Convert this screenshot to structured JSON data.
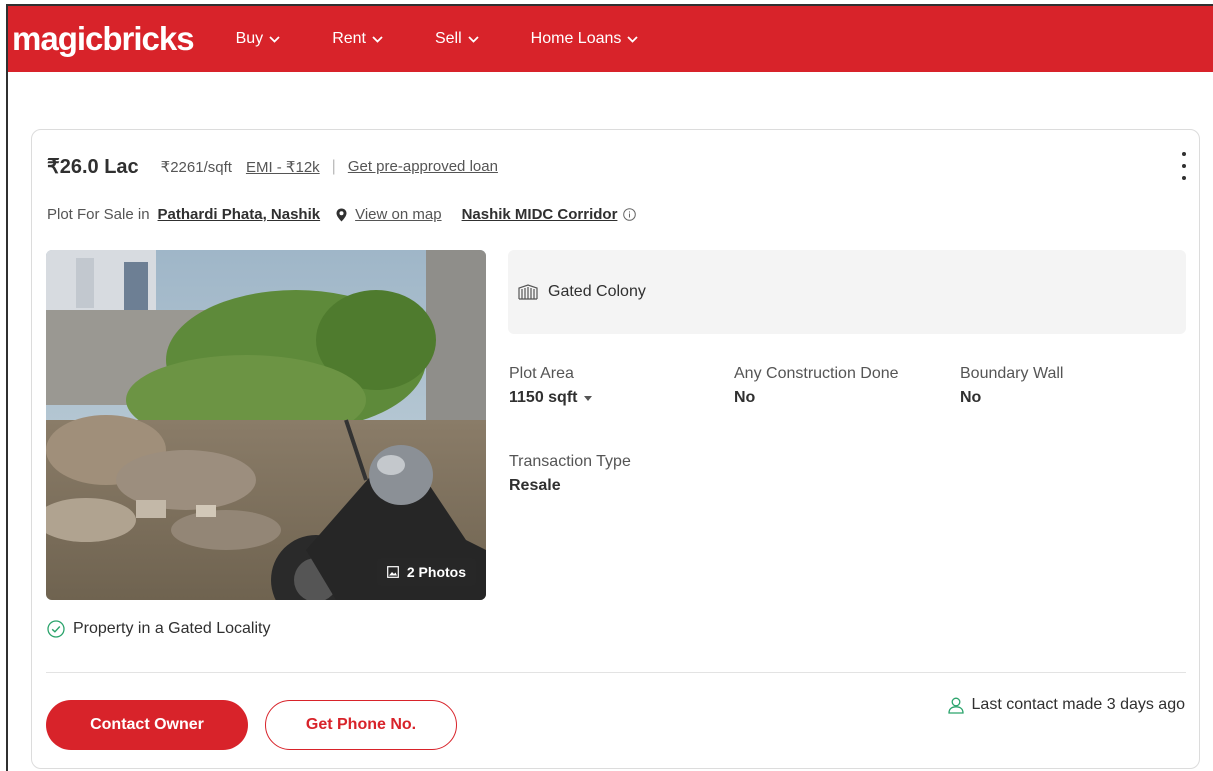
{
  "header": {
    "logo": "magicbricks",
    "nav": [
      {
        "label": "Buy"
      },
      {
        "label": "Rent"
      },
      {
        "label": "Sell"
      },
      {
        "label": "Home Loans"
      }
    ]
  },
  "listing": {
    "price": "₹26.0 Lac",
    "price_per_sqft": "₹2261/sqft",
    "emi": "EMI - ₹12k",
    "separator": "|",
    "loan_link": "Get pre-approved loan",
    "title_prefix": "Plot For Sale in",
    "locality": "Pathardi Phata, Nashik",
    "map_link": "View on map",
    "corridor": "Nashik MIDC Corridor",
    "photo_count": "2 Photos",
    "amenity": "Gated Colony",
    "summary": {
      "plot_area_label": "Plot Area",
      "plot_area_value": "1150 sqft",
      "construction_label": "Any Construction Done",
      "construction_value": "No",
      "boundary_label": "Boundary Wall",
      "boundary_value": "No",
      "transaction_label": "Transaction Type",
      "transaction_value": "Resale"
    },
    "highlight": "Property in a Gated Locality",
    "contact_button": "Contact Owner",
    "phone_button": "Get Phone No.",
    "last_contact": "Last contact made 3 days ago"
  },
  "colors": {
    "brand_red": "#d8232a",
    "green_accent": "#2aa36b"
  }
}
